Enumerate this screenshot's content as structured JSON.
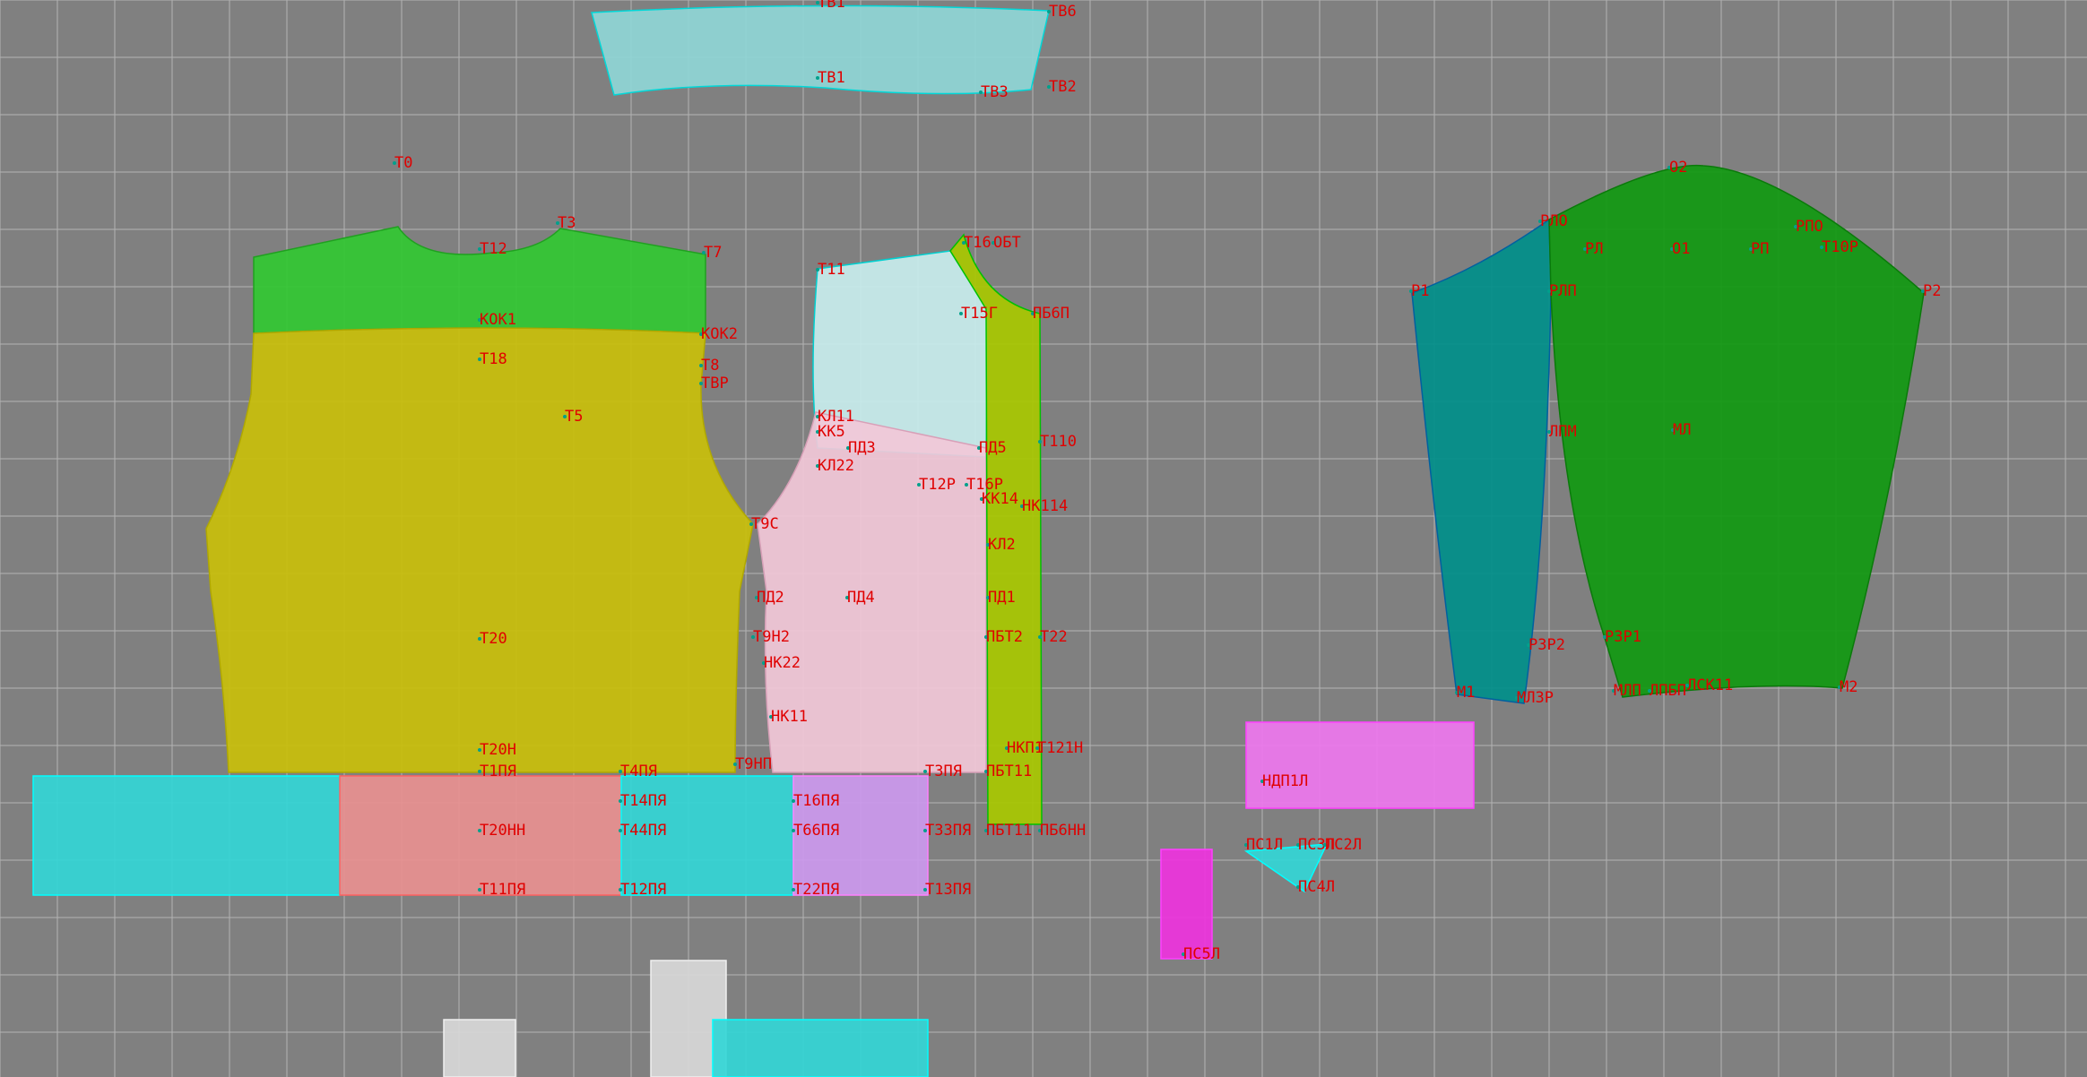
{
  "workspace": {
    "background": "#808080",
    "grid_color": "#b3b3b3",
    "label_color": "#e00000",
    "node_color": "#00a08c"
  },
  "pieces": {
    "waistband": {
      "fill": "#8fd6d6",
      "stroke": "#00d8d8"
    },
    "back_yoke": {
      "fill": "#32c832",
      "stroke": "#20a020"
    },
    "back_body": {
      "fill": "#c9bf0a",
      "stroke": "#b0a800"
    },
    "front_upper": {
      "fill": "#c8eded",
      "stroke": "#00d0d0"
    },
    "front_placket": {
      "fill": "#a8c800",
      "stroke": "#00c000"
    },
    "front_lower": {
      "fill": "#f2c8d8",
      "stroke": "#d8a0b8"
    },
    "sleeve_under": {
      "fill": "#008f8a",
      "stroke": "#0060a0"
    },
    "sleeve_upper": {
      "fill": "#119911",
      "stroke": "#0a7a0a"
    },
    "cuff_cyan": {
      "fill": "#33d6d6",
      "stroke": "#00ffff"
    },
    "cuff_pink": {
      "fill": "#e89090",
      "stroke": "#ff6060"
    },
    "cuff_violet": {
      "fill": "#cc99ee",
      "stroke": "#ff80ff"
    },
    "magenta": {
      "fill": "#ee77ee",
      "stroke": "#ff40ff"
    },
    "magenta_small": {
      "fill": "#ee33dd",
      "stroke": "#ff40ff"
    },
    "small_cyan": {
      "fill": "#33d6d6",
      "stroke": "#00ffff"
    },
    "white_piece": {
      "fill": "#d8d8d8",
      "stroke": "#f0f0f0"
    }
  },
  "labels": {
    "waistband": [
      "ТВ1",
      "ТВ6",
      "ТВ1",
      "ТВ3",
      "ТВ2"
    ],
    "back": [
      "Т0",
      "Т12",
      "Т3",
      "Т7",
      "КОК1",
      "КОК2",
      "Т18",
      "Т8",
      "ТВР",
      "Т5",
      "Т20",
      "Т20Н",
      "Т1ПЯ"
    ],
    "front": [
      "Т11",
      "Т16",
      "ОБТ",
      "Т15Г",
      "ПБ6П",
      "КЛ11",
      "КК5",
      "ПД3",
      "ПД5",
      "Т110",
      "КЛ22",
      "Т12Р",
      "Т16Р",
      "КК14",
      "НК114",
      "Т9С",
      "КЛ2",
      "ПД2",
      "ПД4",
      "ПД1",
      "Т9Н2",
      "ПБТ2",
      "Т22",
      "НК22",
      "НК11",
      "НКП1",
      "Т121Н",
      "Т9НП",
      "Т3ПЯ",
      "ПБТ11",
      "Т4ПЯ"
    ],
    "bottom": [
      "Т14ПЯ",
      "Т16ПЯ",
      "Т20НН",
      "Т44ПЯ",
      "Т66ПЯ",
      "Т33ПЯ",
      "ПБТ11",
      "ПБ6НН",
      "Т11ПЯ",
      "Т12ПЯ",
      "Т22ПЯ",
      "Т13ПЯ"
    ],
    "sleeve": [
      "О2",
      "РПО",
      "РЛО",
      "РЛ",
      "О1",
      "РП",
      "Т10Р",
      "Р1",
      "РЛП",
      "Р2",
      "ЛПМ",
      "МЛ",
      "Р3Р2",
      "Р3Р1",
      "М1",
      "МЛЗР",
      "МЛП",
      "ЛПБП",
      "ЛСК11",
      "М2"
    ],
    "small": [
      "НДП1Л",
      "ПС1Л",
      "ПС3Л",
      "ПС2Л",
      "ПС4Л",
      "ПС5Л"
    ]
  }
}
